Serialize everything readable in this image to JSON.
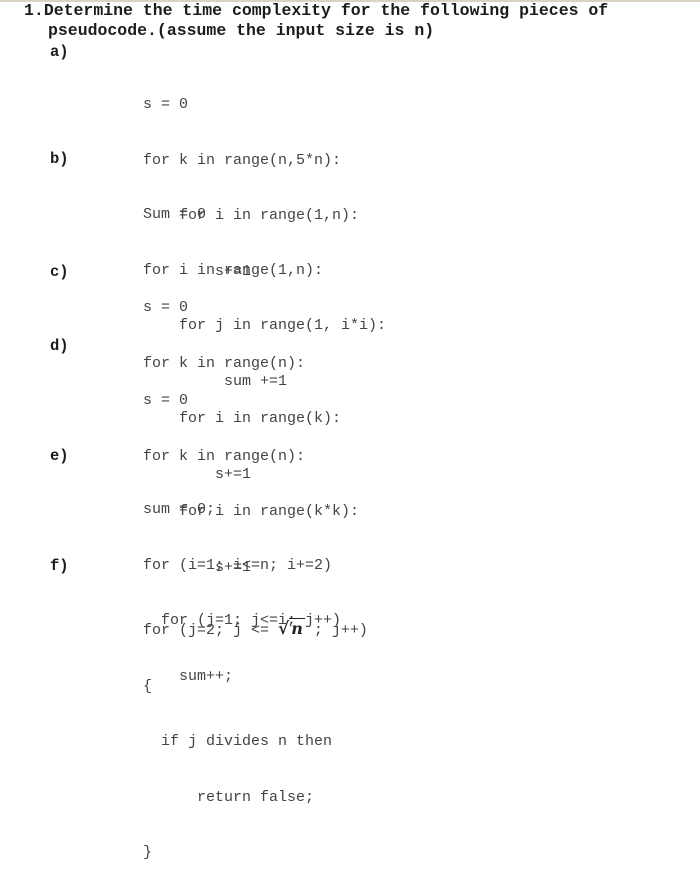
{
  "question": {
    "number": "1.",
    "line1": "Determine the time complexity for the following pieces of",
    "line2": "pseudocode.(assume the input size is n)"
  },
  "parts": [
    {
      "label": "a)",
      "code": [
        "s = 0",
        "for k in range(n,5*n):",
        "    for i in range(1,n):",
        "        s+=1"
      ]
    },
    {
      "label": "b)",
      "code": [
        "Sum = 0",
        "for i in range(1,n):",
        "    for j in range(1, i*i):",
        "         sum +=1"
      ]
    },
    {
      "label": "c)",
      "code": [
        "s = 0",
        "for k in range(n):",
        "    for i in range(k):",
        "        s+=1"
      ]
    },
    {
      "label": "d)",
      "code": [
        "s = 0",
        "for k in range(n):",
        "    for i in range(k*k):",
        "        s+=1"
      ]
    },
    {
      "label": "e)",
      "code": [
        "sum = 0;",
        "for (i=1; i<=n; i+=2)",
        "  for (j=1; j<=i; j++)",
        "    sum++;"
      ]
    },
    {
      "label": "f)",
      "code_prefix": "for (j=2; j <= ",
      "sqrt_symbol": "√",
      "sqrt_var": "n",
      "code_suffix": " ; j++)",
      "code": [
        "{",
        "  if j divides n then",
        "      return false;",
        "}"
      ]
    }
  ]
}
